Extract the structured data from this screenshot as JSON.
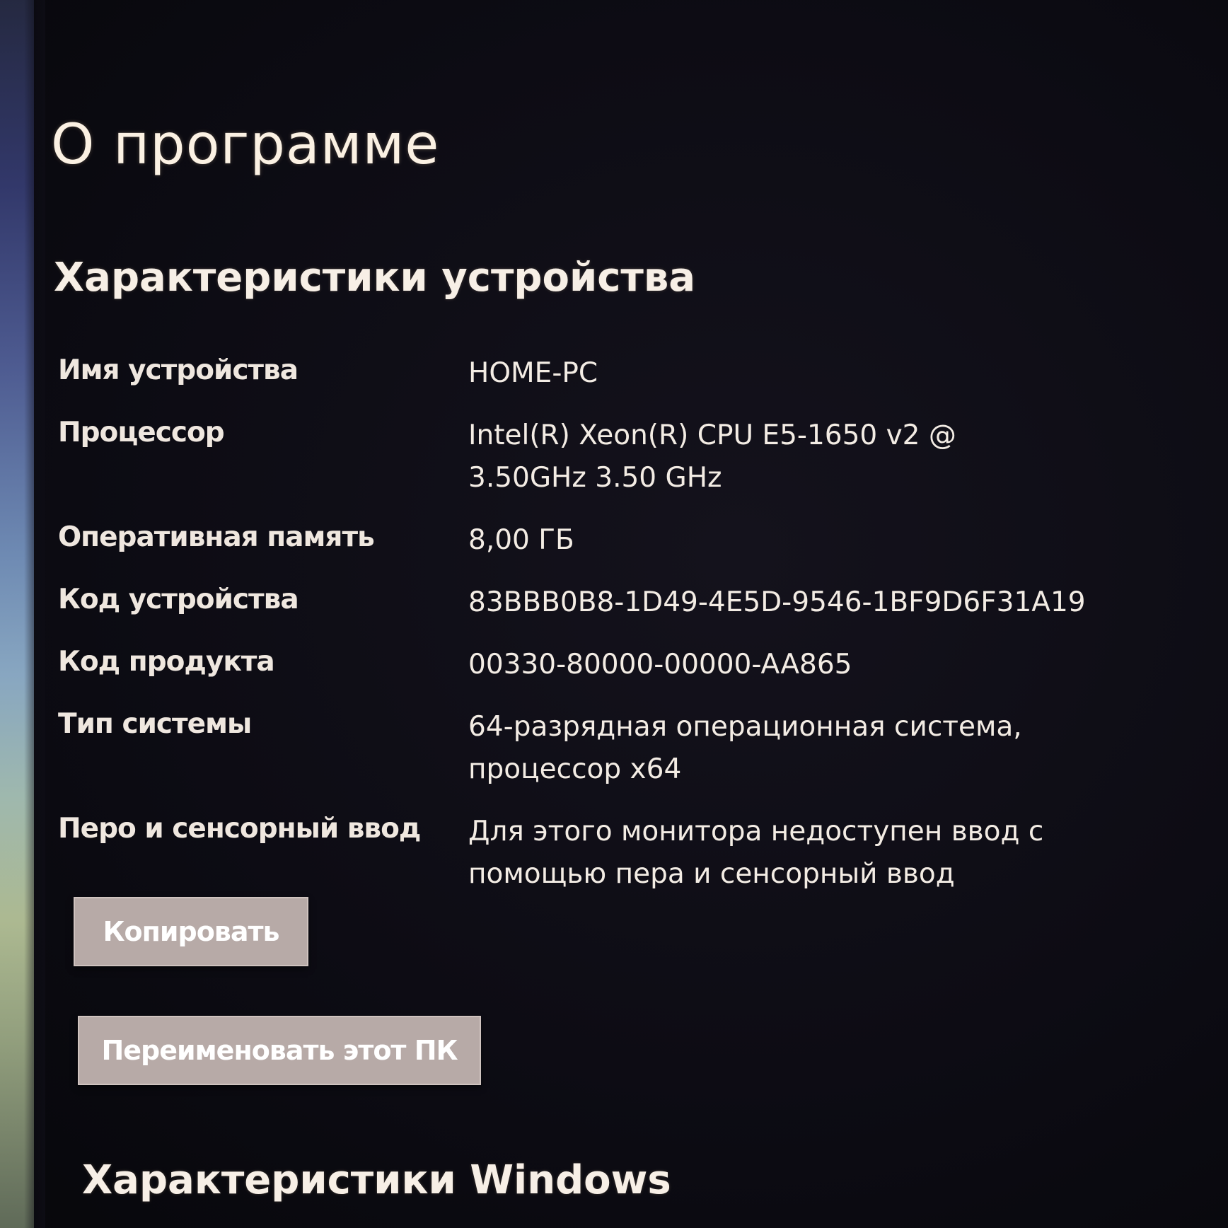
{
  "page": {
    "title": "О программе"
  },
  "device_specs": {
    "heading": "Характеристики устройства",
    "rows": [
      {
        "label": "Имя устройства",
        "value": "HOME-PC"
      },
      {
        "label": "Процессор",
        "value": "Intel(R) Xeon(R) CPU E5-1650 v2 @ 3.50GHz   3.50 GHz"
      },
      {
        "label": "Оперативная память",
        "value": "8,00 ГБ"
      },
      {
        "label": "Код устройства",
        "value": "83BBB0B8-1D49-4E5D-9546-1BF9D6F31A19"
      },
      {
        "label": "Код продукта",
        "value": "00330-80000-00000-AA865"
      },
      {
        "label": "Тип системы",
        "value": "64-разрядная операционная система, процессор x64"
      },
      {
        "label": "Перо и сенсорный ввод",
        "value": "Для этого монитора недоступен ввод с помощью пера и сенсорный ввод"
      }
    ],
    "copy_button": "Копировать",
    "rename_button": "Переименовать этот ПК"
  },
  "windows_specs": {
    "heading": "Характеристики Windows"
  }
}
